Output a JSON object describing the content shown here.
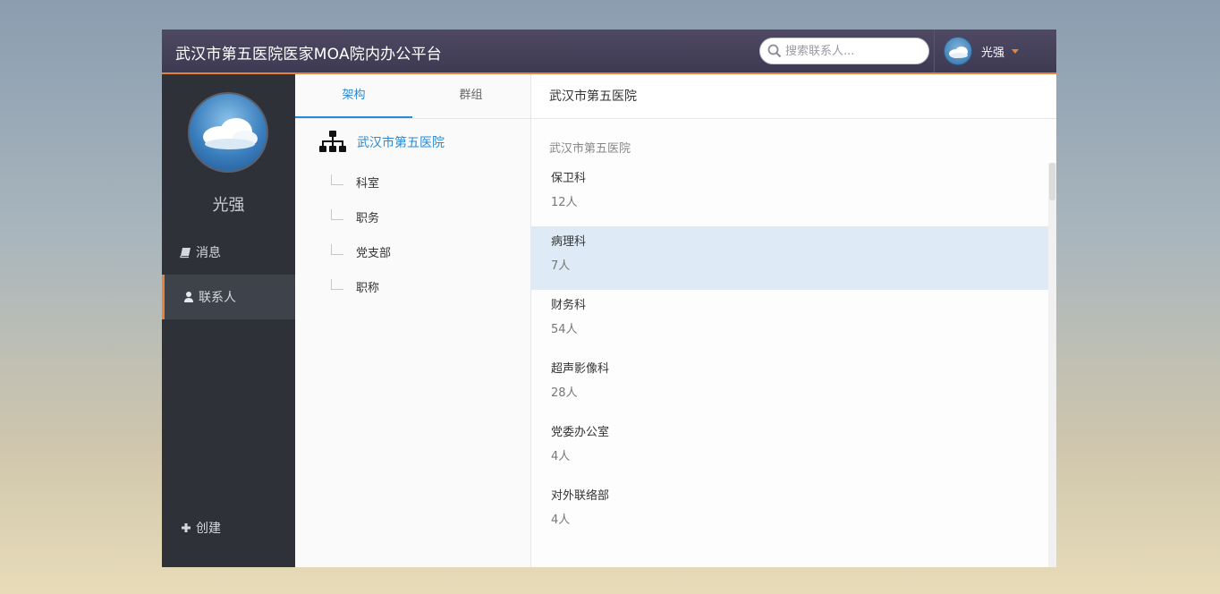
{
  "header": {
    "app_title": "武汉市第五医院医家MOA院内办公平台",
    "search_placeholder": "搜索联系人...",
    "user_name": "光强"
  },
  "sidebar": {
    "user_name": "光强",
    "nav": [
      {
        "label": "消息",
        "icon": "book-icon"
      },
      {
        "label": "联系人",
        "icon": "user-icon"
      }
    ],
    "create_label": "创建"
  },
  "tree": {
    "tabs": [
      "架构",
      "群组"
    ],
    "root": "武汉市第五医院",
    "children": [
      "科室",
      "职务",
      "党支部",
      "职称"
    ]
  },
  "content": {
    "header_title": "武汉市第五医院",
    "section_title": "武汉市第五医院",
    "departments": [
      {
        "name": "保卫科",
        "count": "12人"
      },
      {
        "name": "病理科",
        "count": "7人"
      },
      {
        "name": "财务科",
        "count": "54人"
      },
      {
        "name": "超声影像科",
        "count": "28人"
      },
      {
        "name": "党委办公室",
        "count": "4人"
      },
      {
        "name": "对外联络部",
        "count": "4人"
      }
    ]
  },
  "colors": {
    "accent": "#e8833a",
    "link_blue": "#2a8ad4",
    "selected_row": "#deebf7",
    "sidebar_bg": "#2e3138",
    "topbar_bg": "#3e3a52"
  }
}
